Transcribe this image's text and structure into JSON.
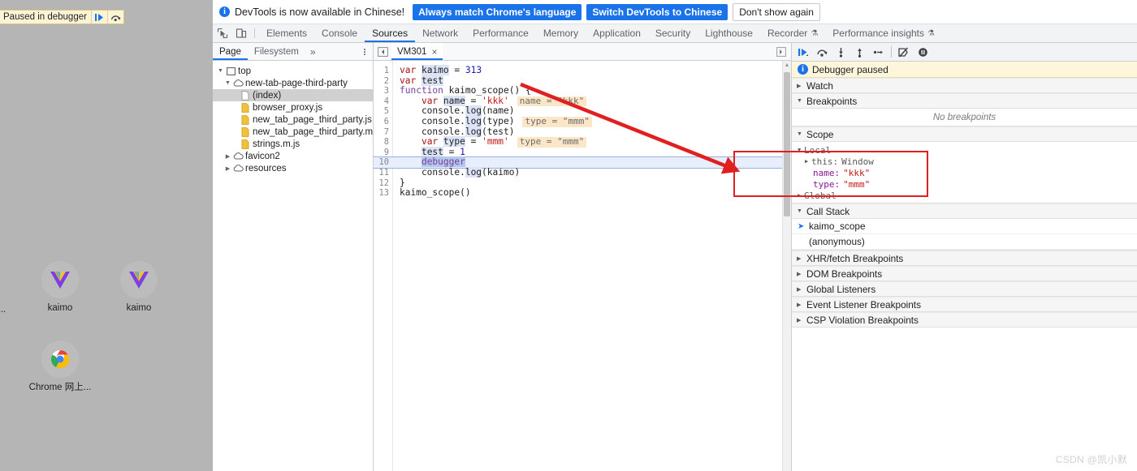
{
  "desktop": {
    "paused_bar": {
      "label": "Paused in debugger",
      "resume_icon": "resume-icon",
      "step_over_icon": "step-over-icon"
    },
    "icons": [
      {
        "name": "kaimo",
        "label": "kaimo",
        "icon": "vue-logo-icon"
      },
      {
        "name": "kaimo2",
        "label": "kaimo",
        "icon": "vue-logo-icon"
      },
      {
        "name": "chrome-webstore",
        "label": "Chrome 网上...",
        "icon": "chrome-logo-icon"
      }
    ],
    "edge_label": "邑..."
  },
  "notification": {
    "icon": "info-icon",
    "text": "DevTools is now available in Chinese!",
    "buttons": [
      {
        "label": "Always match Chrome's language",
        "style": "primary"
      },
      {
        "label": "Switch DevTools to Chinese",
        "style": "primary"
      },
      {
        "label": "Don't show again",
        "style": "secondary"
      }
    ]
  },
  "toolbar": {
    "inspect_icon": "inspect-element-icon",
    "device_icon": "device-toolbar-icon",
    "tabs": [
      {
        "label": "Elements",
        "active": false,
        "flask": false
      },
      {
        "label": "Console",
        "active": false,
        "flask": false
      },
      {
        "label": "Sources",
        "active": true,
        "flask": false
      },
      {
        "label": "Network",
        "active": false,
        "flask": false
      },
      {
        "label": "Performance",
        "active": false,
        "flask": false
      },
      {
        "label": "Memory",
        "active": false,
        "flask": false
      },
      {
        "label": "Application",
        "active": false,
        "flask": false
      },
      {
        "label": "Security",
        "active": false,
        "flask": false
      },
      {
        "label": "Lighthouse",
        "active": false,
        "flask": false
      },
      {
        "label": "Recorder",
        "active": false,
        "flask": true
      },
      {
        "label": "Performance insights",
        "active": false,
        "flask": true
      }
    ]
  },
  "navigator": {
    "tabs": [
      {
        "label": "Page",
        "active": true
      },
      {
        "label": "Filesystem",
        "active": false
      }
    ],
    "more_label": "»",
    "kebab_icon": "more-options-icon",
    "tree": [
      {
        "label": "top",
        "indent": 0,
        "twisty": "down",
        "icon": "frame-icon",
        "selected": false
      },
      {
        "label": "new-tab-page-third-party",
        "indent": 1,
        "twisty": "down",
        "icon": "cloud-icon",
        "selected": false
      },
      {
        "label": "(index)",
        "indent": 2,
        "twisty": "none",
        "icon": "document-icon",
        "selected": true
      },
      {
        "label": "browser_proxy.js",
        "indent": 2,
        "twisty": "none",
        "icon": "js-file-icon",
        "selected": false
      },
      {
        "label": "new_tab_page_third_party.js",
        "indent": 2,
        "twisty": "none",
        "icon": "js-file-icon",
        "selected": false
      },
      {
        "label": "new_tab_page_third_party.mojo",
        "indent": 2,
        "twisty": "none",
        "icon": "js-file-icon",
        "selected": false
      },
      {
        "label": "strings.m.js",
        "indent": 2,
        "twisty": "none",
        "icon": "js-file-icon",
        "selected": false
      },
      {
        "label": "favicon2",
        "indent": 1,
        "twisty": "right",
        "icon": "cloud-icon",
        "selected": false
      },
      {
        "label": "resources",
        "indent": 1,
        "twisty": "right",
        "icon": "cloud-icon",
        "selected": false
      }
    ]
  },
  "editor": {
    "panel_icon": "show-navigator-icon",
    "tab": {
      "label": "VM301",
      "close_icon": "close-icon"
    },
    "right_icon": "more-tabs-icon",
    "lines": [
      {
        "n": "1",
        "text": "var kaimo = 313",
        "inline": ""
      },
      {
        "n": "2",
        "text": "var test",
        "inline": ""
      },
      {
        "n": "3",
        "text": "function kaimo_scope() {",
        "inline": ""
      },
      {
        "n": "4",
        "text": "    var name = 'kkk'",
        "inline": "name = \"kkk\""
      },
      {
        "n": "5",
        "text": "    console.log(name)",
        "inline": ""
      },
      {
        "n": "6",
        "text": "    console.log(type)",
        "inline": "type = \"mmm\""
      },
      {
        "n": "7",
        "text": "    console.log(test)",
        "inline": ""
      },
      {
        "n": "8",
        "text": "    var type = 'mmm'",
        "inline": "type = \"mmm\""
      },
      {
        "n": "9",
        "text": "    test = 1",
        "inline": ""
      },
      {
        "n": "10",
        "text": "    debugger",
        "inline": ""
      },
      {
        "n": "11",
        "text": "    console.log(kaimo)",
        "inline": ""
      },
      {
        "n": "12",
        "text": "}",
        "inline": ""
      },
      {
        "n": "13",
        "text": "kaimo_scope()",
        "inline": ""
      }
    ],
    "current_line": "10"
  },
  "debugger": {
    "controls": [
      {
        "name": "resume-button",
        "icon": "resume-icon"
      },
      {
        "name": "step-over-button",
        "icon": "step-over-icon"
      },
      {
        "name": "step-into-button",
        "icon": "step-into-icon"
      },
      {
        "name": "step-out-button",
        "icon": "step-out-icon"
      },
      {
        "name": "step-button",
        "icon": "step-icon"
      },
      {
        "name": "deactivate-breakpoints-button",
        "icon": "deactivate-breakpoints-icon"
      },
      {
        "name": "pause-on-exceptions-button",
        "icon": "pause-on-exceptions-icon"
      }
    ],
    "paused_banner": {
      "icon": "info-icon",
      "text": "Debugger paused"
    },
    "sections": [
      {
        "label": "Watch",
        "state": "collapsed"
      },
      {
        "label": "Breakpoints",
        "state": "expanded",
        "empty_text": "No breakpoints"
      },
      {
        "label": "Scope",
        "state": "expanded"
      },
      {
        "label": "Call Stack",
        "state": "expanded"
      },
      {
        "label": "XHR/fetch Breakpoints",
        "state": "collapsed"
      },
      {
        "label": "DOM Breakpoints",
        "state": "collapsed"
      },
      {
        "label": "Global Listeners",
        "state": "collapsed"
      },
      {
        "label": "Event Listener Breakpoints",
        "state": "collapsed"
      },
      {
        "label": "CSP Violation Breakpoints",
        "state": "collapsed"
      }
    ],
    "scope": {
      "local_label": "Local",
      "global_label": "Global",
      "entries": [
        {
          "name": "this:",
          "value": "Window",
          "kind": "object",
          "twisty": "right"
        },
        {
          "name": "name:",
          "value": "\"kkk\"",
          "kind": "string",
          "twisty": "none"
        },
        {
          "name": "type:",
          "value": "\"mmm\"",
          "kind": "string",
          "twisty": "none"
        }
      ]
    },
    "call_stack": [
      {
        "label": "kaimo_scope",
        "current": true
      },
      {
        "label": "(anonymous)",
        "current": false
      }
    ]
  },
  "annotations": {
    "highlight_color": "#e02020",
    "arrow": "red-arrow",
    "rectangle": "red-rectangle"
  },
  "watermark": "CSDN @凯小默"
}
